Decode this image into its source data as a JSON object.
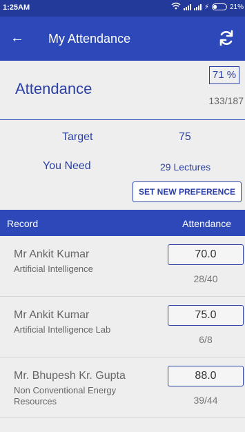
{
  "status_bar": {
    "time": "1:25AM",
    "signal": "..ıl ..ıl",
    "battery": "21%"
  },
  "app_bar": {
    "title": "My Attendance"
  },
  "summary": {
    "title": "Attendance",
    "percent": "71 %",
    "count": "133/187"
  },
  "target": {
    "target_label": "Target",
    "target_value": "75",
    "need_label": "You Need",
    "need_value": "29 Lectures",
    "preference_button": "SET NEW PREFERENCE"
  },
  "records_header": {
    "left": "Record",
    "right": "Attendance"
  },
  "records": [
    {
      "teacher": "Mr Ankit Kumar",
      "subject": "Artificial Intelligence",
      "value": "70.0",
      "count": "28/40"
    },
    {
      "teacher": "Mr Ankit Kumar",
      "subject": "Artificial Intelligence Lab",
      "value": "75.0",
      "count": "6/8"
    },
    {
      "teacher": "Mr. Bhupesh Kr. Gupta",
      "subject": "Non Conventional Energy Resources",
      "value": "88.0",
      "count": "39/44"
    }
  ],
  "icons": {
    "back": "arrow-left-icon",
    "refresh": "refresh-icon",
    "wifi": "wifi-icon",
    "signal": "signal-icon",
    "battery": "battery-icon"
  },
  "colors": {
    "primary": "#2d49b9",
    "primary_dark": "#233a9a",
    "accent_text": "#2b3fa5"
  }
}
